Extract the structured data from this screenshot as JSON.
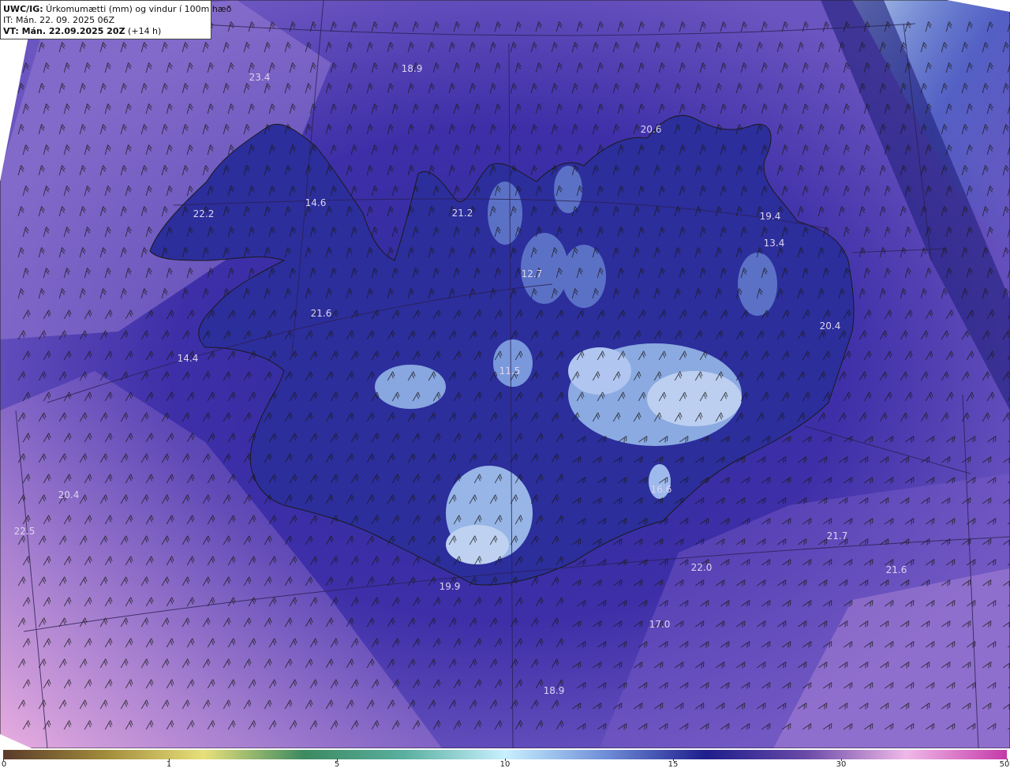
{
  "header": {
    "title_bold": "UWC/IG:",
    "title_rest": " Úrkomumætti (mm) og vindur í 100m hæð",
    "it": "IT: Mán. 22. 09. 2025 06Z",
    "vt_bold": "VT: Mán. 22.09.2025 20Z",
    "vt_rest": " (+14 h)"
  },
  "labels": [
    {
      "text": "23.4"
    },
    {
      "text": "18.9"
    },
    {
      "text": "20.6"
    },
    {
      "text": "22.2"
    },
    {
      "text": "14.6"
    },
    {
      "text": "21.2"
    },
    {
      "text": "19.4"
    },
    {
      "text": "13.4"
    },
    {
      "text": "12.7"
    },
    {
      "text": "21.6"
    },
    {
      "text": "20.4"
    },
    {
      "text": "14.4"
    },
    {
      "text": "11.5"
    },
    {
      "text": "20.4"
    },
    {
      "text": "22.5"
    },
    {
      "text": "16.6"
    },
    {
      "text": "21.7"
    },
    {
      "text": "22.0"
    },
    {
      "text": "21.6"
    },
    {
      "text": "19.9"
    },
    {
      "text": "17.0"
    },
    {
      "text": "18.9"
    }
  ],
  "colorbar": {
    "ticks": [
      "0",
      "1",
      "5",
      "10",
      "15",
      "30",
      "50"
    ],
    "colors": [
      "#5a3a2a",
      "#a08a3a",
      "#e8e07a",
      "#3c8a60",
      "#5ab0a0",
      "#c8f0ff",
      "#6f8ed8",
      "#1e1e8c",
      "#6a4aa8",
      "#f0b8e8",
      "#c43aa8"
    ]
  },
  "icons": {
    "wind": "wind-barb-icon"
  }
}
